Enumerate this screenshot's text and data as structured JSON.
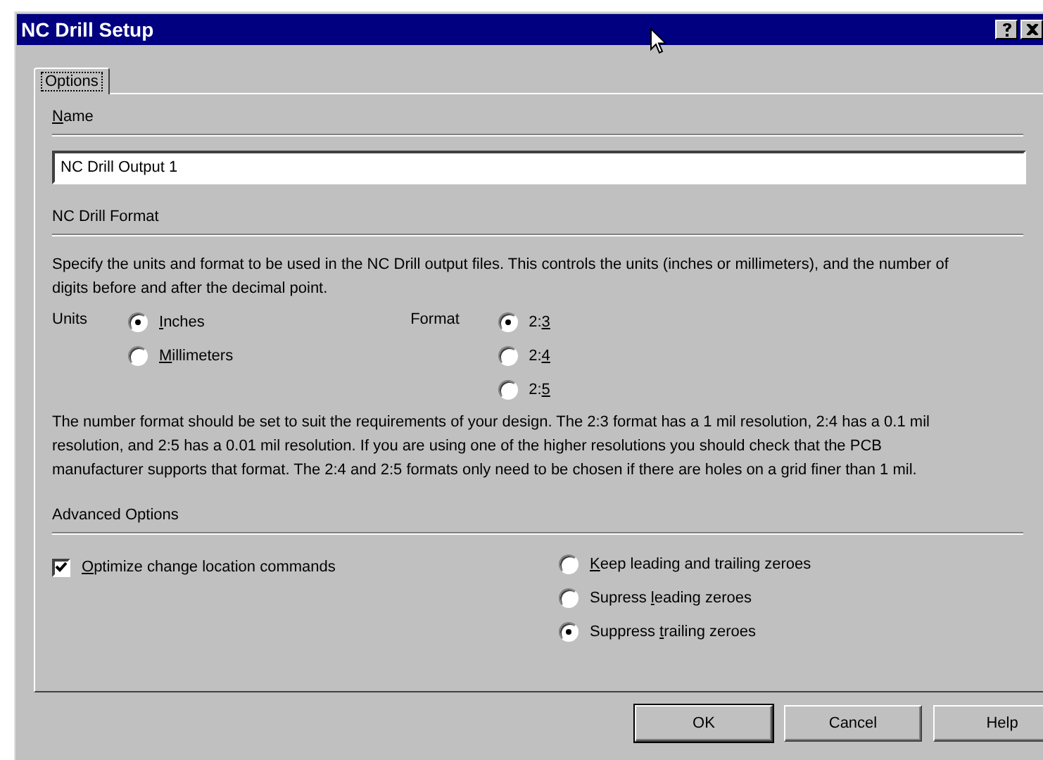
{
  "window": {
    "title": "NC Drill Setup"
  },
  "tabs": [
    {
      "label": "Options",
      "selected": true
    }
  ],
  "name_section": {
    "access_key": "N",
    "label_rest": "ame",
    "value": "NC Drill Output 1"
  },
  "format_section": {
    "title": "NC Drill Format",
    "description": "Specify the units and format to be used in the NC Drill output files. This controls the units (inches or millimeters), and the number of digits before and after the decimal point.",
    "units": {
      "label": "Units",
      "options": [
        {
          "access_key": "I",
          "label_rest": "nches",
          "selected": true
        },
        {
          "access_key": "M",
          "label_rest": "illimeters",
          "selected": false
        }
      ]
    },
    "format": {
      "label": "Format",
      "options": [
        {
          "label_start": "2:",
          "access_key": "3",
          "selected": true
        },
        {
          "label_start": "2:",
          "access_key": "4",
          "selected": false
        },
        {
          "label_start": "2:",
          "access_key": "5",
          "selected": false
        }
      ]
    },
    "note": "The number format should be set to suit the requirements of your design. The 2:3 format has a 1 mil resolution, 2:4 has a 0.1 mil resolution, and 2:5 has a 0.01 mil resolution. If you are using one of the higher resolutions you should check that the PCB manufacturer supports that format. The 2:4 and 2:5 formats only need to be chosen if there are holes on a grid finer than 1 mil."
  },
  "advanced_section": {
    "title": "Advanced Options",
    "optimize": {
      "access_key": "O",
      "label_rest": "ptimize change location commands",
      "checked": true
    },
    "zeroes": [
      {
        "access_key": "K",
        "label_rest": "eep leading and trailing zeroes",
        "selected": false
      },
      {
        "label_start": "Supress ",
        "access_key": "l",
        "label_rest": "eading zeroes",
        "selected": false
      },
      {
        "label_start": "Suppress ",
        "access_key": "t",
        "label_rest": "railing zeroes",
        "selected": true
      }
    ]
  },
  "buttons": [
    {
      "label": "OK",
      "default": true
    },
    {
      "label": "Cancel",
      "default": false
    },
    {
      "label": "Help",
      "default": false
    }
  ]
}
